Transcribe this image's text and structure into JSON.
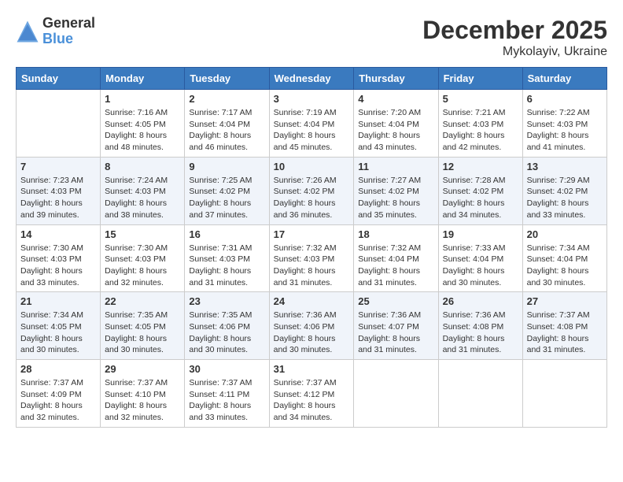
{
  "logo": {
    "general": "General",
    "blue": "Blue"
  },
  "header": {
    "month": "December 2025",
    "location": "Mykolayiv, Ukraine"
  },
  "weekdays": [
    "Sunday",
    "Monday",
    "Tuesday",
    "Wednesday",
    "Thursday",
    "Friday",
    "Saturday"
  ],
  "weeks": [
    [
      {
        "day": "",
        "info": ""
      },
      {
        "day": "1",
        "info": "Sunrise: 7:16 AM\nSunset: 4:05 PM\nDaylight: 8 hours\nand 48 minutes."
      },
      {
        "day": "2",
        "info": "Sunrise: 7:17 AM\nSunset: 4:04 PM\nDaylight: 8 hours\nand 46 minutes."
      },
      {
        "day": "3",
        "info": "Sunrise: 7:19 AM\nSunset: 4:04 PM\nDaylight: 8 hours\nand 45 minutes."
      },
      {
        "day": "4",
        "info": "Sunrise: 7:20 AM\nSunset: 4:04 PM\nDaylight: 8 hours\nand 43 minutes."
      },
      {
        "day": "5",
        "info": "Sunrise: 7:21 AM\nSunset: 4:03 PM\nDaylight: 8 hours\nand 42 minutes."
      },
      {
        "day": "6",
        "info": "Sunrise: 7:22 AM\nSunset: 4:03 PM\nDaylight: 8 hours\nand 41 minutes."
      }
    ],
    [
      {
        "day": "7",
        "info": "Sunrise: 7:23 AM\nSunset: 4:03 PM\nDaylight: 8 hours\nand 39 minutes."
      },
      {
        "day": "8",
        "info": "Sunrise: 7:24 AM\nSunset: 4:03 PM\nDaylight: 8 hours\nand 38 minutes."
      },
      {
        "day": "9",
        "info": "Sunrise: 7:25 AM\nSunset: 4:02 PM\nDaylight: 8 hours\nand 37 minutes."
      },
      {
        "day": "10",
        "info": "Sunrise: 7:26 AM\nSunset: 4:02 PM\nDaylight: 8 hours\nand 36 minutes."
      },
      {
        "day": "11",
        "info": "Sunrise: 7:27 AM\nSunset: 4:02 PM\nDaylight: 8 hours\nand 35 minutes."
      },
      {
        "day": "12",
        "info": "Sunrise: 7:28 AM\nSunset: 4:02 PM\nDaylight: 8 hours\nand 34 minutes."
      },
      {
        "day": "13",
        "info": "Sunrise: 7:29 AM\nSunset: 4:02 PM\nDaylight: 8 hours\nand 33 minutes."
      }
    ],
    [
      {
        "day": "14",
        "info": "Sunrise: 7:30 AM\nSunset: 4:03 PM\nDaylight: 8 hours\nand 33 minutes."
      },
      {
        "day": "15",
        "info": "Sunrise: 7:30 AM\nSunset: 4:03 PM\nDaylight: 8 hours\nand 32 minutes."
      },
      {
        "day": "16",
        "info": "Sunrise: 7:31 AM\nSunset: 4:03 PM\nDaylight: 8 hours\nand 31 minutes."
      },
      {
        "day": "17",
        "info": "Sunrise: 7:32 AM\nSunset: 4:03 PM\nDaylight: 8 hours\nand 31 minutes."
      },
      {
        "day": "18",
        "info": "Sunrise: 7:32 AM\nSunset: 4:04 PM\nDaylight: 8 hours\nand 31 minutes."
      },
      {
        "day": "19",
        "info": "Sunrise: 7:33 AM\nSunset: 4:04 PM\nDaylight: 8 hours\nand 30 minutes."
      },
      {
        "day": "20",
        "info": "Sunrise: 7:34 AM\nSunset: 4:04 PM\nDaylight: 8 hours\nand 30 minutes."
      }
    ],
    [
      {
        "day": "21",
        "info": "Sunrise: 7:34 AM\nSunset: 4:05 PM\nDaylight: 8 hours\nand 30 minutes."
      },
      {
        "day": "22",
        "info": "Sunrise: 7:35 AM\nSunset: 4:05 PM\nDaylight: 8 hours\nand 30 minutes."
      },
      {
        "day": "23",
        "info": "Sunrise: 7:35 AM\nSunset: 4:06 PM\nDaylight: 8 hours\nand 30 minutes."
      },
      {
        "day": "24",
        "info": "Sunrise: 7:36 AM\nSunset: 4:06 PM\nDaylight: 8 hours\nand 30 minutes."
      },
      {
        "day": "25",
        "info": "Sunrise: 7:36 AM\nSunset: 4:07 PM\nDaylight: 8 hours\nand 31 minutes."
      },
      {
        "day": "26",
        "info": "Sunrise: 7:36 AM\nSunset: 4:08 PM\nDaylight: 8 hours\nand 31 minutes."
      },
      {
        "day": "27",
        "info": "Sunrise: 7:37 AM\nSunset: 4:08 PM\nDaylight: 8 hours\nand 31 minutes."
      }
    ],
    [
      {
        "day": "28",
        "info": "Sunrise: 7:37 AM\nSunset: 4:09 PM\nDaylight: 8 hours\nand 32 minutes."
      },
      {
        "day": "29",
        "info": "Sunrise: 7:37 AM\nSunset: 4:10 PM\nDaylight: 8 hours\nand 32 minutes."
      },
      {
        "day": "30",
        "info": "Sunrise: 7:37 AM\nSunset: 4:11 PM\nDaylight: 8 hours\nand 33 minutes."
      },
      {
        "day": "31",
        "info": "Sunrise: 7:37 AM\nSunset: 4:12 PM\nDaylight: 8 hours\nand 34 minutes."
      },
      {
        "day": "",
        "info": ""
      },
      {
        "day": "",
        "info": ""
      },
      {
        "day": "",
        "info": ""
      }
    ]
  ]
}
